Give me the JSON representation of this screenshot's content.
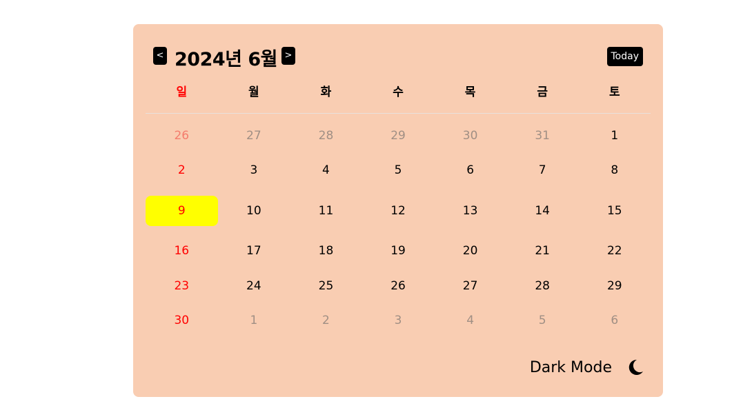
{
  "calendar": {
    "title": "2024년 6월",
    "prev_label": "<",
    "next_label": ">",
    "today_label": "Today",
    "weekdays": [
      "일",
      "월",
      "화",
      "수",
      "목",
      "금",
      "토"
    ],
    "weeks": [
      [
        "26",
        "27",
        "28",
        "29",
        "30",
        "31",
        "1"
      ],
      [
        "2",
        "3",
        "4",
        "5",
        "6",
        "7",
        "8"
      ],
      [
        "9",
        "10",
        "11",
        "12",
        "13",
        "14",
        "15"
      ],
      [
        "16",
        "17",
        "18",
        "19",
        "20",
        "21",
        "22"
      ],
      [
        "23",
        "24",
        "25",
        "26",
        "27",
        "28",
        "29"
      ],
      [
        "30",
        "1",
        "2",
        "3",
        "4",
        "5",
        "6"
      ]
    ],
    "other_month_days": [
      [
        true,
        true,
        true,
        true,
        true,
        true,
        false
      ],
      [
        false,
        false,
        false,
        false,
        false,
        false,
        false
      ],
      [
        false,
        false,
        false,
        false,
        false,
        false,
        false
      ],
      [
        false,
        false,
        false,
        false,
        false,
        false,
        false
      ],
      [
        false,
        false,
        false,
        false,
        false,
        false,
        false
      ],
      [
        false,
        true,
        true,
        true,
        true,
        true,
        true
      ]
    ],
    "highlighted_day": "9"
  },
  "footer": {
    "dark_mode_label": "Dark Mode",
    "dark_mode_icon": "moon-icon"
  },
  "colors": {
    "background": "#f9cdb2",
    "sunday": "#ff0000",
    "highlight": "#ffff00",
    "button": "#000000"
  }
}
